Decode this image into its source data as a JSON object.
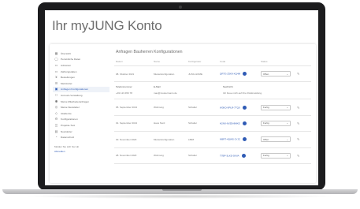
{
  "page": {
    "title": "Ihr myJUNG Konto"
  },
  "sidebar": {
    "items": [
      {
        "label": "Übersicht",
        "icon": "grid-icon"
      },
      {
        "label": "Persönliche Daten",
        "icon": "user-icon"
      },
      {
        "label": "Adressen",
        "icon": "address-icon"
      },
      {
        "label": "Zahlungsdaten",
        "icon": "card-icon"
      },
      {
        "label": "Bestellungen",
        "icon": "cart-icon"
      },
      {
        "label": "Merkzettel",
        "icon": "list-icon"
      },
      {
        "label": "Anfragen Konfigurationen",
        "icon": "config-icon",
        "active": true
      },
      {
        "label": "Account-Verwaltung",
        "icon": "users-icon"
      },
      {
        "label": "Meine Mitarbeiteranfragen",
        "icon": "team-icon"
      },
      {
        "label": "Meine Newsletter",
        "icon": "mail-icon"
      },
      {
        "label": "Akademie",
        "icon": "academy-icon"
      },
      {
        "label": "Konfigurationen",
        "icon": "gear-icon"
      },
      {
        "label": "Projekte-Tool",
        "icon": "project-icon"
      },
      {
        "label": "Newsletter",
        "icon": "newsletter-icon"
      },
      {
        "label": "Datenschutz",
        "icon": "lock-icon"
      }
    ],
    "footer_text": "Melden Sie sich hier ab",
    "logout_label": "Abmelden"
  },
  "main": {
    "section_title": "Anfragen Bauherren Konfigurationen",
    "columns": [
      "Datum",
      "Name",
      "Konfigurator",
      "Code",
      "Status",
      ""
    ],
    "rows": [
      {
        "date": "08. Oktober 2021",
        "name": "Musterkonfiguration",
        "configurator": "JUNG HOME",
        "code": "QR7G-Z5K9-XQ4M",
        "status": "Offen",
        "expanded": true,
        "detail": {
          "label_a": "Telefonnummer",
          "label_b": "E-Mail",
          "label_c": "Nachricht",
          "value_a": "+49 123 456 78",
          "value_b": "max@mustermann.de",
          "value_c": "Ich freue mich auf Ihre Rückmeldung."
        }
      },
      {
        "date": "05. September 2021",
        "name": "Wohnung",
        "configurator": "Schalter",
        "code": "W3KD-9PLR-7TQX",
        "status": "Fertig",
        "expanded": false
      },
      {
        "date": "01. September 2021",
        "name": "Haus Nord",
        "configurator": "Schalter",
        "code": "H2NX-6VZB-8MKE",
        "status": "Fertig",
        "expanded": false
      },
      {
        "date": "30. November 2020",
        "name": "Musterkonfiguration",
        "configurator": "LB48",
        "code": "M9RT-4QWS-2YJC",
        "status": "Offen",
        "expanded": false
      },
      {
        "date": "28. November 2020",
        "name": "Wohnung",
        "configurator": "Schalter",
        "code": "T7BP-3LKD-5NVA",
        "status": "Fertig",
        "expanded": false
      }
    ]
  },
  "colors": {
    "accent": "#2f5bb5",
    "text": "#6e6e6e",
    "laptop_bezel": "#1c1c1e"
  }
}
